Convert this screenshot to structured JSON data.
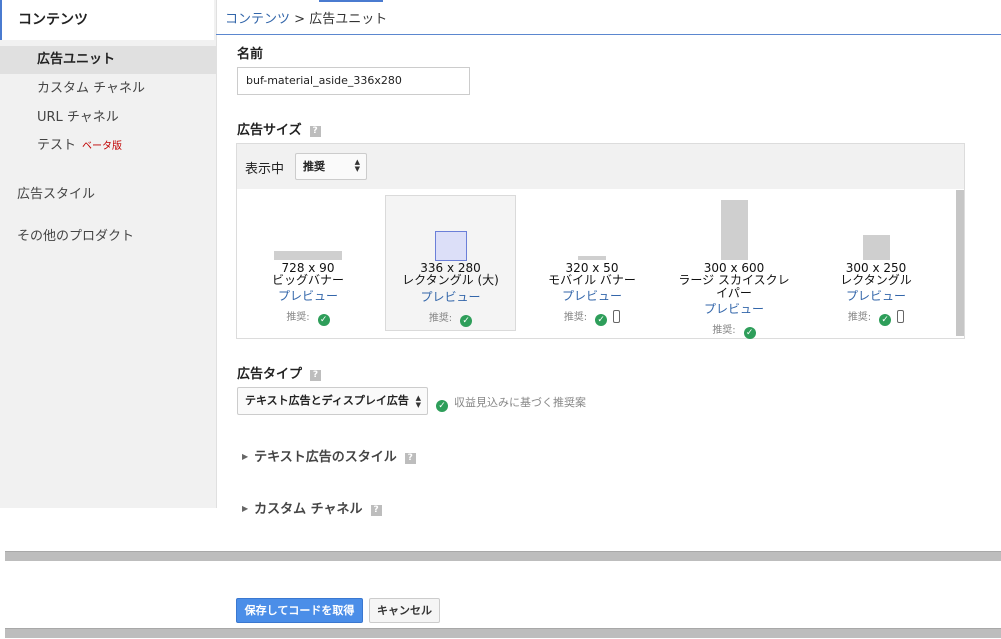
{
  "sidebar": {
    "header": "コンテンツ",
    "items": [
      {
        "label": "広告ユニット",
        "active": true
      },
      {
        "label": "カスタム チャネル"
      },
      {
        "label": "URL チャネル"
      },
      {
        "label": "テスト",
        "badge": "ベータ版"
      }
    ],
    "sections": [
      "広告スタイル",
      "その他のプロダクト"
    ]
  },
  "breadcrumb": {
    "parent": "コンテンツ",
    "separator": " > ",
    "current": "広告ユニット"
  },
  "form": {
    "name_label": "名前",
    "name_value": "buf-material_aside_336x280",
    "size_label": "広告サイズ",
    "help_glyph": "?",
    "display_label": "表示中",
    "display_select": "推奨",
    "sizes": [
      {
        "dims": "728 x 90",
        "name": "ビッグバナー",
        "preview": "プレビュー",
        "rec": "推奨:",
        "mobile": false
      },
      {
        "dims": "336 x 280",
        "name": "レクタングル (大)",
        "preview": "プレビュー",
        "rec": "推奨:",
        "mobile": false,
        "selected": true
      },
      {
        "dims": "320 x 50",
        "name": "モバイル バナー",
        "preview": "プレビュー",
        "rec": "推奨:",
        "mobile": true
      },
      {
        "dims": "300 x 600",
        "name_line1": "ラージ スカイスクレ",
        "name_line2": "イパー",
        "preview": "プレビュー",
        "rec": "推奨:",
        "mobile": false
      },
      {
        "dims": "300 x 250",
        "name": "レクタングル",
        "preview": "プレビュー",
        "rec": "推奨:",
        "mobile": true
      }
    ],
    "type_label": "広告タイプ",
    "type_select": "テキスト広告とディスプレイ広告",
    "type_note": "収益見込みに基づく推奨案",
    "text_style_label": "テキスト広告のスタイル",
    "custom_channel_label": "カスタム チャネル",
    "save_button": "保存してコードを取得",
    "cancel_button": "キャンセル"
  },
  "icons": {
    "check": "check-circle-icon",
    "mobile": "mobile-phone-icon",
    "collapse": "triangle-right-icon",
    "select": "up-down-arrows-icon"
  },
  "colors": {
    "link": "#3366aa",
    "primary": "#4b8ee8",
    "check": "#2e9e5a",
    "beta": "#c00000"
  }
}
